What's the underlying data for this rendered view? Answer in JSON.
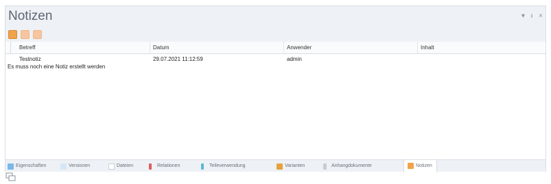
{
  "window": {
    "title": "Notizen",
    "controls": [
      "▾",
      "ᵼ",
      "×"
    ]
  },
  "toolbar": {
    "buttons": [
      "new-note",
      "edit-note",
      "delete-note"
    ]
  },
  "grid": {
    "columns": [
      "Betreff",
      "Datum",
      "Anwender",
      "Inhalt"
    ],
    "rows": [
      {
        "betreff": "Testnotiz",
        "datum": "29.07.2021 11:12:59",
        "anwender": "admin",
        "inhalt": ""
      }
    ],
    "detail": "Es muss noch eine Notiz erstellt werden"
  },
  "tabs": [
    {
      "label": "Eigenschaften",
      "color": "#7ab8e8"
    },
    {
      "label": "Versionen",
      "color": "#d7e6f5"
    },
    {
      "label": "Dateien",
      "color": "#ffffff"
    },
    {
      "label": "Relationen",
      "color": "#e05c5c"
    },
    {
      "label": "Teileverwendung",
      "color": "#5bb8d6"
    },
    {
      "label": "Varianten",
      "color": "#e6a23c"
    },
    {
      "label": "Anhangdokumente",
      "color": "#c9cdd2"
    },
    {
      "label": "Notizen",
      "color": "#f0a34a",
      "active": true
    }
  ],
  "colors": {
    "header_bg": "#eef1f5",
    "border": "#d9dde3",
    "title_text": "#5d6672",
    "accent": "#f0a34a"
  }
}
